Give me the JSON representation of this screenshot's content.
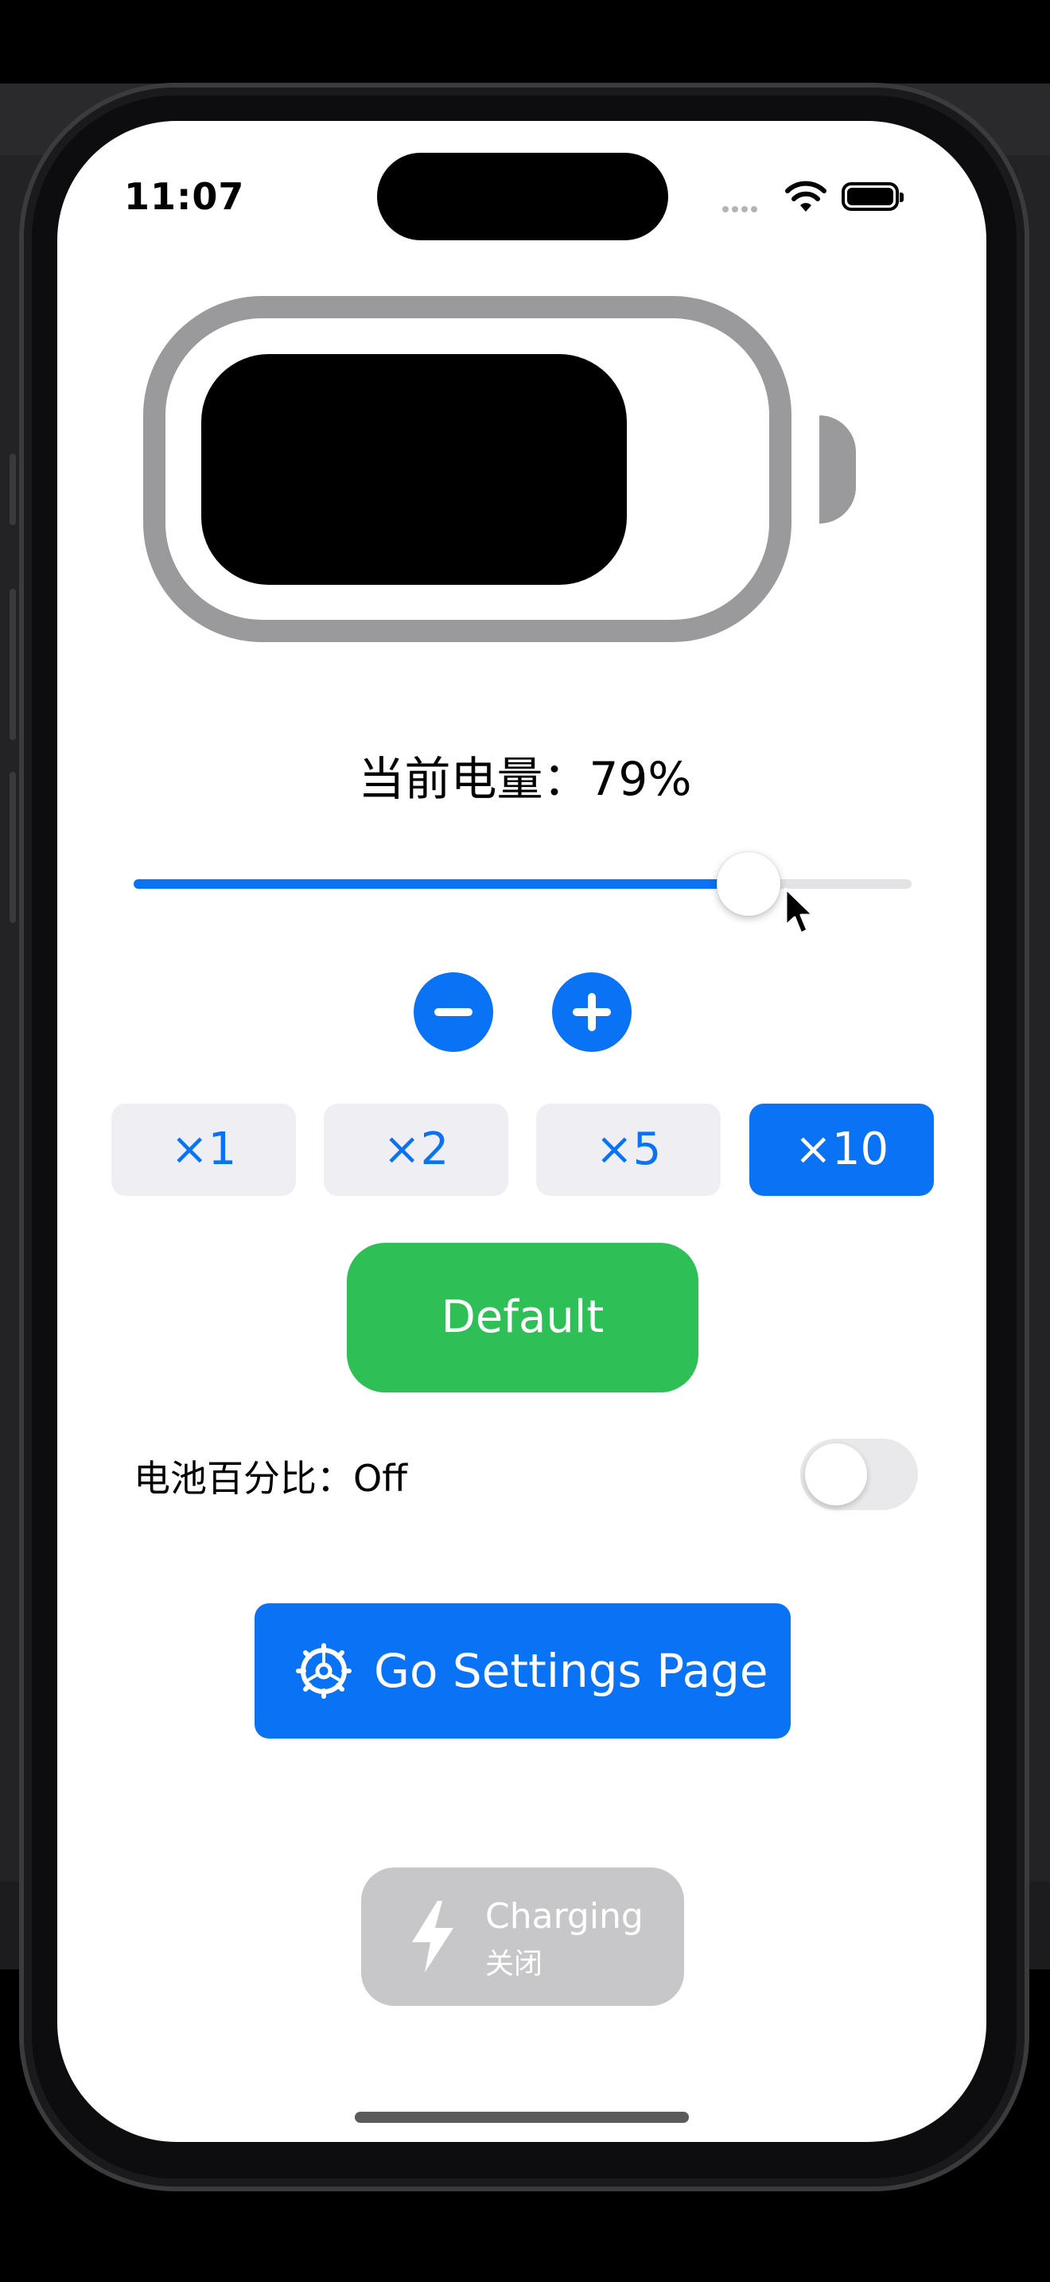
{
  "status_bar": {
    "time": "11:07"
  },
  "battery": {
    "level_percent": 79,
    "level_text": "当前电量：79%"
  },
  "stepper": {
    "decrement_icon": "minus-circle-icon",
    "increment_icon": "plus-circle-icon"
  },
  "multipliers": [
    {
      "label": "×1",
      "selected": false
    },
    {
      "label": "×2",
      "selected": false
    },
    {
      "label": "×5",
      "selected": false
    },
    {
      "label": "×10",
      "selected": true
    }
  ],
  "default_button": {
    "label": "Default"
  },
  "percentage_toggle": {
    "label": "电池百分比：Off",
    "on": false
  },
  "settings_button": {
    "label": "Go Settings Page",
    "icon": "gear-icon"
  },
  "charging_button": {
    "title": "Charging",
    "subtitle": "关闭",
    "icon": "bolt-icon"
  },
  "colors": {
    "accent": "#0a72f5",
    "default_green": "#2fbf57",
    "battery_gray": "#9a9a9c",
    "disabled_gray": "#c7c7ca"
  }
}
